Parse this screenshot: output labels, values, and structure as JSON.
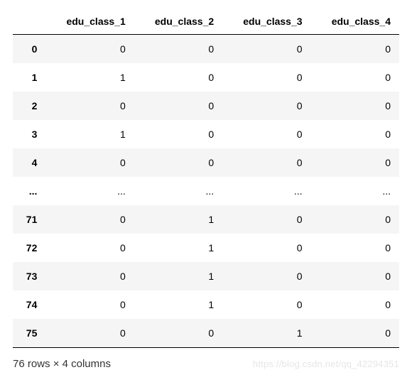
{
  "chart_data": {
    "type": "table",
    "columns": [
      "edu_class_1",
      "edu_class_2",
      "edu_class_3",
      "edu_class_4"
    ],
    "rows": [
      {
        "index": "0",
        "values": [
          "0",
          "0",
          "0",
          "0"
        ]
      },
      {
        "index": "1",
        "values": [
          "1",
          "0",
          "0",
          "0"
        ]
      },
      {
        "index": "2",
        "values": [
          "0",
          "0",
          "0",
          "0"
        ]
      },
      {
        "index": "3",
        "values": [
          "1",
          "0",
          "0",
          "0"
        ]
      },
      {
        "index": "4",
        "values": [
          "0",
          "0",
          "0",
          "0"
        ]
      },
      {
        "index": "...",
        "values": [
          "...",
          "...",
          "...",
          "..."
        ]
      },
      {
        "index": "71",
        "values": [
          "0",
          "1",
          "0",
          "0"
        ]
      },
      {
        "index": "72",
        "values": [
          "0",
          "1",
          "0",
          "0"
        ]
      },
      {
        "index": "73",
        "values": [
          "0",
          "1",
          "0",
          "0"
        ]
      },
      {
        "index": "74",
        "values": [
          "0",
          "1",
          "0",
          "0"
        ]
      },
      {
        "index": "75",
        "values": [
          "0",
          "0",
          "1",
          "0"
        ]
      }
    ],
    "shape_text": "76 rows × 4 columns"
  },
  "watermark": "https://blog.csdn.net/qq_42294351"
}
